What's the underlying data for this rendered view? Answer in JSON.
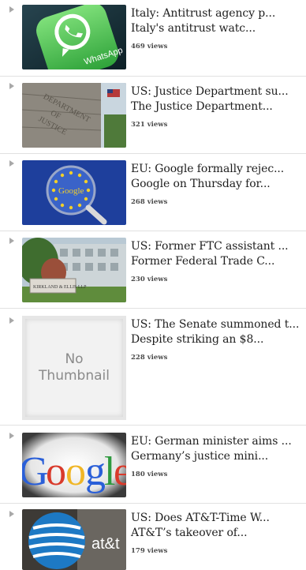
{
  "articles": [
    {
      "title": "Italy: Antitrust agency p...",
      "snippet": "Italy's antitrust watc...",
      "views": "469 views",
      "thumb_icon": "whatsapp-logo-image"
    },
    {
      "title": "US: Justice Department su...",
      "snippet": "The Justice Department...",
      "views": "321 views",
      "thumb_icon": "department-of-justice-building-image"
    },
    {
      "title": "EU: Google formally rejec...",
      "snippet": "Google on Thursday for...",
      "views": "268 views",
      "thumb_icon": "google-eu-magnifier-image"
    },
    {
      "title": "US: Former FTC assistant ...",
      "snippet": "Former Federal Trade C...",
      "views": "230 views",
      "thumb_icon": "kirkland-ellis-building-image"
    },
    {
      "title": "US: The Senate summoned t...",
      "snippet": "Despite striking an $8...",
      "views": "228 views",
      "thumb_text": "No Thumbnail"
    },
    {
      "title": "EU: German minister aims ...",
      "snippet": "Germany’s justice mini...",
      "views": "180 views",
      "thumb_icon": "google-logo-image"
    },
    {
      "title": "US: Does AT&T-Time W...",
      "snippet": "AT&T’s takeover of...",
      "views": "179 views",
      "thumb_icon": "att-logo-image"
    }
  ],
  "colors": {
    "text": "#1e1e1e",
    "views": "#4a4a4a",
    "separator": "#e1e1e1",
    "arrow": "#a8a8a8"
  }
}
